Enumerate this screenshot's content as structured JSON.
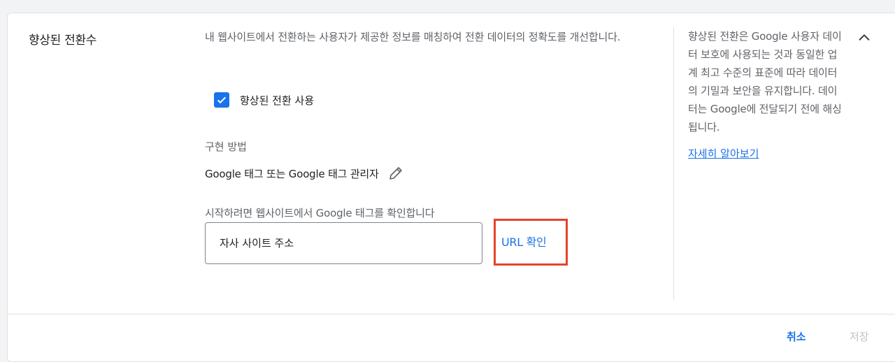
{
  "section": {
    "title": "향상된 전환수",
    "description": "내 웹사이트에서 전환하는 사용자가 제공한 정보를 매칭하여 전환 데이터의 정확도를 개선합니다."
  },
  "checkbox": {
    "label": "향상된 전환 사용",
    "checked": true,
    "icon": "check-icon"
  },
  "implementation": {
    "label": "구현 방법",
    "value": "Google 태그 또는 Google 태그 관리자",
    "edit_icon": "pencil-icon"
  },
  "url_check": {
    "label": "시작하려면 웹사이트에서 Google 태그를 확인합니다",
    "input_placeholder": "자사 사이트 주소",
    "button_label": "URL 확인"
  },
  "help": {
    "text": "향상된 전환은 Google 사용자 데이터 보호에 사용되는 것과 동일한 업계 최고 수준의 표준에 따라 데이터의 기밀과 보안을 유지합니다. 데이터는 Google에 전달되기 전에 해싱됩니다.",
    "link": "자세히 알아보기",
    "collapse_icon": "chevron-up-icon"
  },
  "footer": {
    "cancel_label": "취소",
    "save_label": "저장"
  },
  "colors": {
    "accent": "#1a73e8",
    "highlight": "#e5432a",
    "disabled": "#bdc1c6"
  }
}
